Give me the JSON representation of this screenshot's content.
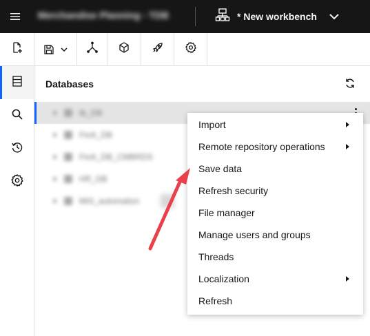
{
  "topbar": {
    "app_title": "Merchandise Planning - TDB",
    "workbench_label": "* New workbench",
    "icons": [
      "hamburger-icon",
      "workbench-icon",
      "chevron-down-icon"
    ]
  },
  "toolbar": {
    "buttons": [
      {
        "name": "new-file-button",
        "icon": "new-file-icon"
      },
      {
        "name": "save-button",
        "icon": "save-icon"
      },
      {
        "name": "merge-button",
        "icon": "merge-icon"
      },
      {
        "name": "cube-button",
        "icon": "cube-icon"
      },
      {
        "name": "rocket-button",
        "icon": "rocket-icon"
      },
      {
        "name": "settings-button",
        "icon": "gear-icon"
      }
    ]
  },
  "leftrail": {
    "items": [
      {
        "name": "databases",
        "icon": "database-list-icon",
        "active": true
      },
      {
        "name": "search",
        "icon": "search-icon",
        "active": false
      },
      {
        "name": "history",
        "icon": "history-icon",
        "active": false
      },
      {
        "name": "settings",
        "icon": "gear-icon",
        "active": false
      }
    ]
  },
  "panel": {
    "title": "Databases",
    "rows": [
      {
        "label": "tb_DB"
      },
      {
        "label": "FinA_DB"
      },
      {
        "label": "FinA_DB_CMBRDS"
      },
      {
        "label": "HR_DB"
      },
      {
        "label": "MIS_automation"
      }
    ]
  },
  "context_menu": {
    "items": [
      {
        "label": "Import",
        "submenu": true
      },
      {
        "label": "Remote repository operations",
        "submenu": true
      },
      {
        "label": "Save data",
        "submenu": false
      },
      {
        "label": "Refresh security",
        "submenu": false
      },
      {
        "label": "File manager",
        "submenu": false
      },
      {
        "label": "Manage users and groups",
        "submenu": false
      },
      {
        "label": "Threads",
        "submenu": false
      },
      {
        "label": "Localization",
        "submenu": true
      },
      {
        "label": "Refresh",
        "submenu": false
      }
    ]
  },
  "colors": {
    "topbar_bg": "#161616",
    "accent": "#0f62fe",
    "annotation_arrow": "#e8414b"
  }
}
